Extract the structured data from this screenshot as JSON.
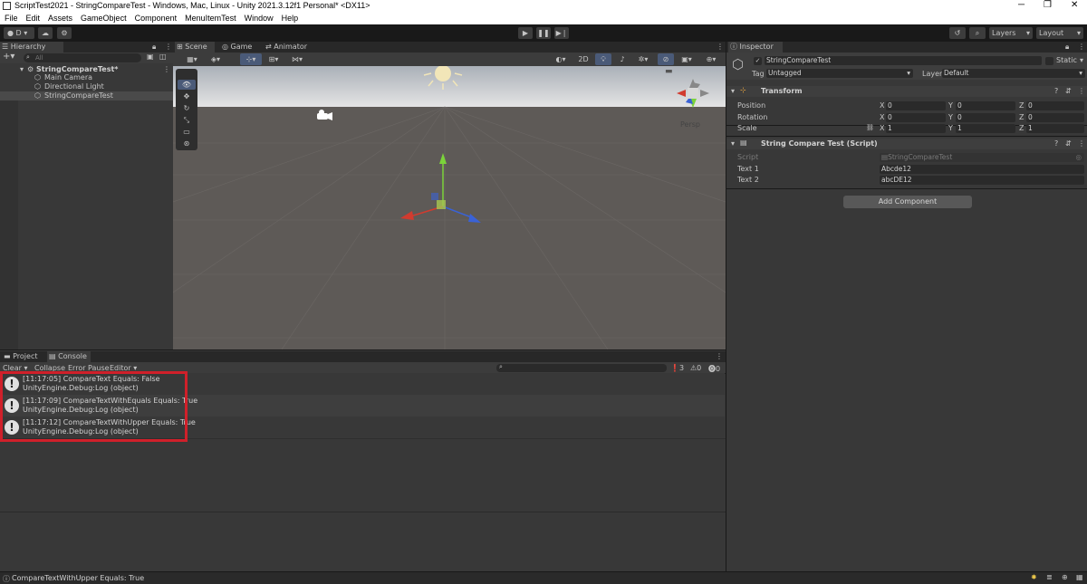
{
  "window": {
    "title": "ScriptTest2021 - StringCompareTest - Windows, Mac, Linux - Unity 2021.3.12f1 Personal* <DX11>"
  },
  "menu": [
    "File",
    "Edit",
    "Assets",
    "GameObject",
    "Component",
    "MenuItemTest",
    "Window",
    "Help"
  ],
  "toolbar": {
    "account_label": "D",
    "layers_label": "Layers",
    "layout_label": "Layout"
  },
  "hierarchy": {
    "tab_label": "Hierarchy",
    "search_placeholder": "All",
    "scene_name": "StringCompareTest*",
    "items": [
      "Main Camera",
      "Directional Light",
      "StringCompareTest"
    ]
  },
  "scene_view": {
    "tabs": [
      "Scene",
      "Game",
      "Animator"
    ],
    "mode_2d": "2D",
    "persp_label": "Persp",
    "colors": {
      "sky": "#b5b9bf",
      "ground": "#5e5a57",
      "x_axis": "#d13b2f",
      "y_axis": "#7bd33a",
      "z_axis": "#3a62d6"
    }
  },
  "inspector": {
    "tab_label": "Inspector",
    "object_name": "StringCompareTest",
    "static_label": "Static",
    "tag_label": "Tag",
    "tag_value": "Untagged",
    "layer_label": "Layer",
    "layer_value": "Default",
    "transform": {
      "title": "Transform",
      "position_label": "Position",
      "rotation_label": "Rotation",
      "scale_label": "Scale",
      "position": {
        "x": "0",
        "y": "0",
        "z": "0"
      },
      "rotation": {
        "x": "0",
        "y": "0",
        "z": "0"
      },
      "scale": {
        "x": "1",
        "y": "1",
        "z": "1"
      },
      "x_label": "X",
      "y_label": "Y",
      "z_label": "Z"
    },
    "script_component": {
      "title": "String Compare Test (Script)",
      "script_label": "Script",
      "script_value": "StringCompareTest",
      "text1_label": "Text 1",
      "text1_value": "Abcde12",
      "text2_label": "Text 2",
      "text2_value": "abcDE12"
    },
    "add_component_label": "Add Component"
  },
  "console": {
    "tabs": [
      "Project",
      "Console"
    ],
    "clear_label": "Clear",
    "collapse_label": "Collapse",
    "error_pause_label": "Error Pause",
    "editor_label": "Editor",
    "count_info": "3",
    "count_warn": "0",
    "count_error": "0",
    "entries": [
      {
        "line1": "[11:17:05] CompareText Equals: False",
        "line2": "UnityEngine.Debug:Log (object)"
      },
      {
        "line1": "[11:17:09] CompareTextWithEquals Equals: True",
        "line2": "UnityEngine.Debug:Log (object)"
      },
      {
        "line1": "[11:17:12] CompareTextWithUpper Equals: True",
        "line2": "UnityEngine.Debug:Log (object)"
      }
    ],
    "highlight_color": "#d0202a"
  },
  "statusbar": {
    "message": "CompareTextWithUpper Equals: True"
  }
}
